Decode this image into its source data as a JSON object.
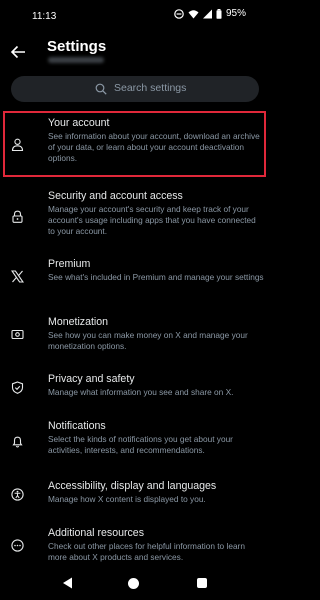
{
  "status": {
    "time": "11:13",
    "battery": "95%"
  },
  "header": {
    "title": "Settings"
  },
  "search": {
    "placeholder": "Search settings"
  },
  "items": [
    {
      "icon": "person-icon",
      "title": "Your account",
      "desc": "See information about your account, download an archive of your data, or learn about your account deactivation options."
    },
    {
      "icon": "lock-icon",
      "title": "Security and account access",
      "desc": "Manage your account's security and keep track of your account's usage including apps that you have connected to your account."
    },
    {
      "icon": "x-logo-icon",
      "title": "Premium",
      "desc": "See what's included in Premium and manage your settings"
    },
    {
      "icon": "money-icon",
      "title": "Monetization",
      "desc": "See how you can make money on X and manage your monetization options."
    },
    {
      "icon": "shield-icon",
      "title": "Privacy and safety",
      "desc": "Manage what information you see and share on X."
    },
    {
      "icon": "bell-icon",
      "title": "Notifications",
      "desc": "Select the kinds of notifications you get about your activities, interests, and recommendations."
    },
    {
      "icon": "accessibility-icon",
      "title": "Accessibility, display and languages",
      "desc": "Manage how X content is displayed to you."
    },
    {
      "icon": "more-circle-icon",
      "title": "Additional resources",
      "desc": "Check out other places for helpful information to learn more about X products and services."
    }
  ],
  "colors": {
    "background": "#000000",
    "highlight": "#e0283a",
    "muted": "#8b98a5",
    "text": "#e7e9ea"
  }
}
